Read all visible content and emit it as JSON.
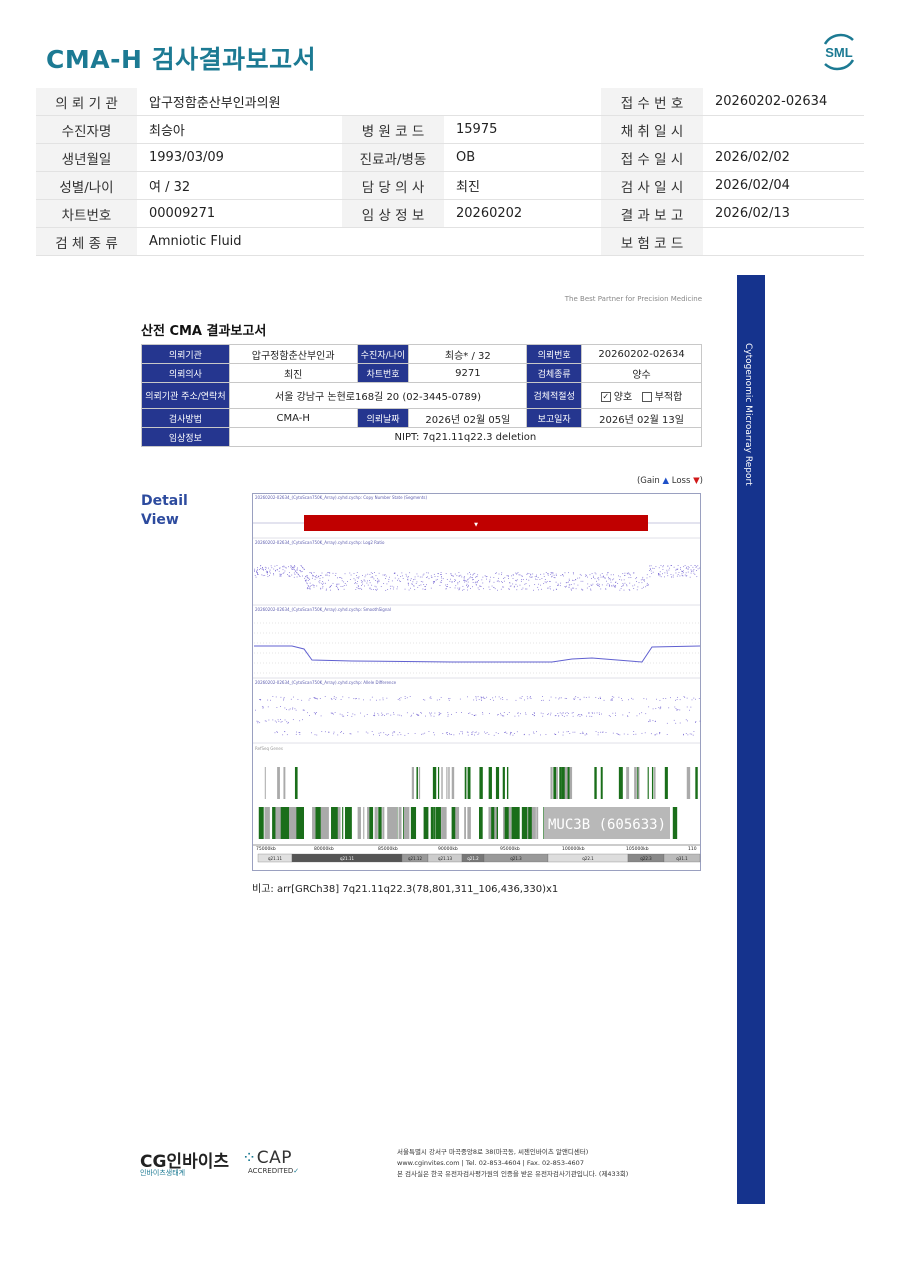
{
  "doc_title": "CMA-H 검사결과보고서",
  "logo_text": "SML",
  "header": {
    "rows": [
      [
        {
          "l": "의 뢰 기 관",
          "v": "압구정함춘산부인과의원"
        },
        {
          "l": "",
          "v": ""
        },
        {
          "l": "접 수 번 호",
          "v": "20260202-02634"
        }
      ],
      [
        {
          "l": "수진자명",
          "v": "최승아"
        },
        {
          "l": "병 원 코 드",
          "v": "15975"
        },
        {
          "l": "채 취 일 시",
          "v": ""
        }
      ],
      [
        {
          "l": "생년월일",
          "v": "1993/03/09"
        },
        {
          "l": "진료과/병동",
          "v": "OB"
        },
        {
          "l": "접 수 일 시",
          "v": "2026/02/02"
        }
      ],
      [
        {
          "l": "성별/나이",
          "v": "여 / 32"
        },
        {
          "l": "담 당 의 사",
          "v": "최진"
        },
        {
          "l": "검 사 일 시",
          "v": "2026/02/04"
        }
      ],
      [
        {
          "l": "차트번호",
          "v": "00009271"
        },
        {
          "l": "임 상 정 보",
          "v": "20260202"
        },
        {
          "l": "결 과 보 고",
          "v": "2026/02/13"
        }
      ],
      [
        {
          "l": "검 체 종 류",
          "v": "Amniotic Fluid"
        },
        {
          "l": "",
          "v": ""
        },
        {
          "l": "보 험 코 드",
          "v": ""
        }
      ]
    ]
  },
  "side_band_text": "Cytogenomic Microarray Report",
  "tagline": "The Best Partner for Precision Medicine",
  "report": {
    "title": "산전 CMA 결과보고서",
    "labels": {
      "institution": "의뢰기관",
      "patient": "수진자/나이",
      "receipt_no": "의뢰번호",
      "doctor": "의뢰의사",
      "chart_no": "차트번호",
      "specimen": "검체종류",
      "address": "의뢰기관 주소/연락처",
      "suitability": "검체적절성",
      "method": "검사방법",
      "request_date": "의뢰날짜",
      "report_date": "보고일자",
      "clinical": "임상정보"
    },
    "values": {
      "institution": "압구정함춘산부인과",
      "patient": "최승* / 32",
      "receipt_no": "20260202-02634",
      "doctor": "최진",
      "chart_no": "9271",
      "specimen": "양수",
      "address": "서울 강남구 논현로168길 20 (02-3445-0789)",
      "suit_good": "양호",
      "suit_bad": "부적합",
      "method": "CMA-H",
      "request_date": "2026년 02월 05일",
      "report_date": "2026년 02월 13일",
      "clinical": "NIPT: 7q21.11q22.3 deletion"
    }
  },
  "legend_gain": "Gain",
  "legend_loss": "Loss",
  "detail_line1": "Detail",
  "detail_line2": "View",
  "plot": {
    "panel1": "20260202-02634_(CytoScan750K_Array).cyhd.cychp: Copy Number State (Segments)",
    "panel2": "20260202-02634_(CytoScan750K_Array).cyhd.cychp: Log2 Ratio",
    "panel3": "20260202-02634_(CytoScan750K_Array).cyhd.cychp: SmoothSignal",
    "panel4": "20260202-02634_(CytoScan750K_Array).cyhd.cychp: Allele Difference",
    "genes_label": "RefSeq Genes",
    "gene_tag": "MUC3B (605633)",
    "bands": [
      "q21.11",
      "q21.11",
      "q21.12",
      "q21.13",
      "q21.2",
      "q21.3",
      "q22.1",
      "q22.3",
      "q31.1"
    ],
    "ticks": [
      "75000kb",
      "80000kb",
      "85000kb",
      "90000kb",
      "95000kb",
      "100000kb",
      "105000kb",
      "110"
    ]
  },
  "note": "비고: arr[GRCh38] 7q21.11q22.3(78,801,311_106,436,330)x1",
  "footer": {
    "cg_main": "CG인바이츠",
    "cg_sub": "인바이츠생태계",
    "cap_main": "CAP",
    "cap_sub": "ACCREDITED",
    "addr1": "서울특별시 강서구 마곡중앙8로 38(마곡동, 씨젠인바이츠 알앤디센터)",
    "addr2": "www.cginvites.com | Tel. 02-853-4604 | Fax. 02-853-4607",
    "addr3": "본 검사실은 한국 유전자검사평가원의 인증을 받은 유전자검사기관입니다. (제433회)"
  }
}
